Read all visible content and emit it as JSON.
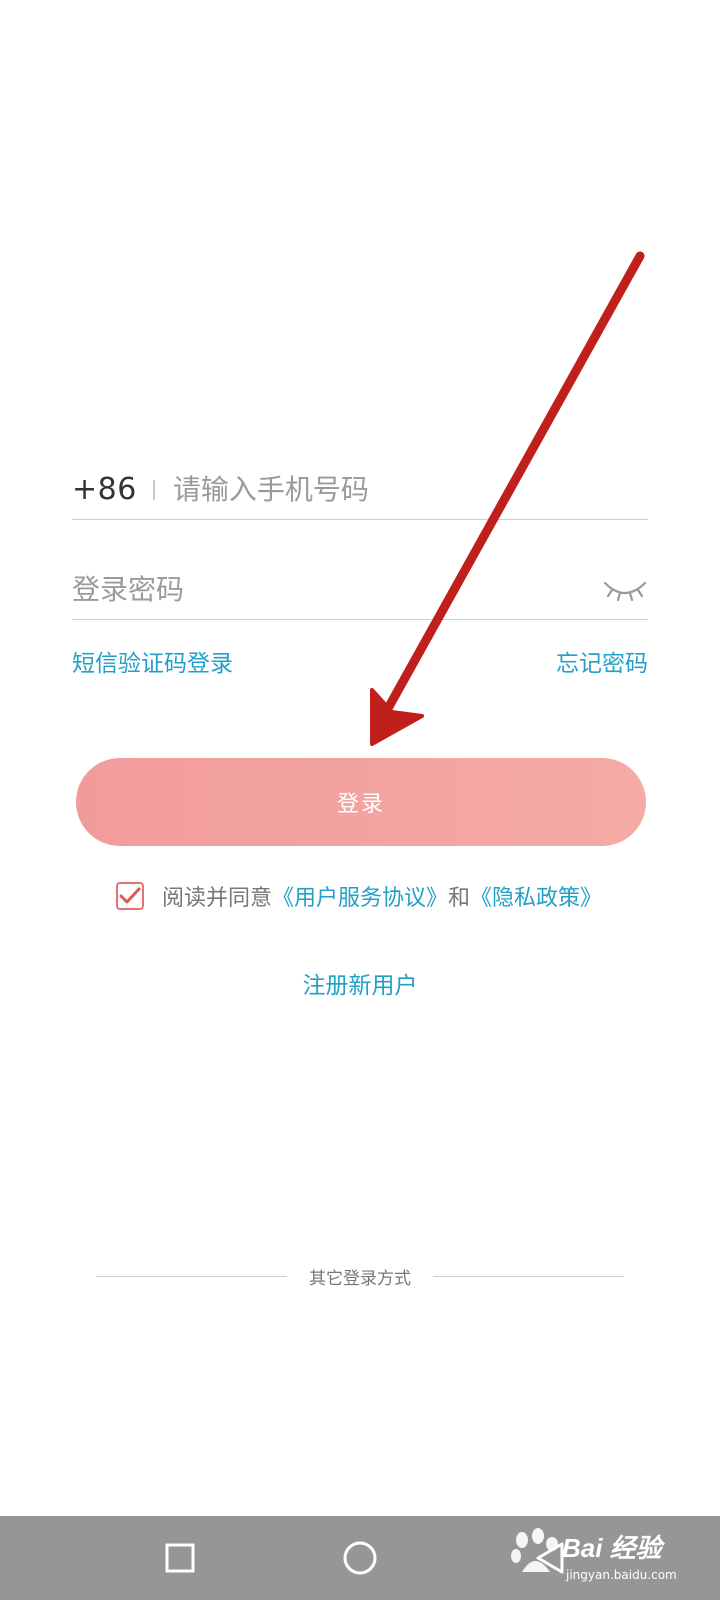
{
  "login": {
    "country_code": "+86",
    "phone_placeholder": "请输入手机号码",
    "password_placeholder": "登录密码",
    "sms_login_label": "短信验证码登录",
    "forgot_password_label": "忘记密码",
    "login_button_label": "登录",
    "agreement": {
      "checked": true,
      "prefix": "阅读并同意",
      "terms_link": "《用户服务协议》",
      "conjunction": "和",
      "privacy_link": "《隐私政策》"
    },
    "register_label": "注册新用户",
    "other_login_label": "其它登录方式"
  },
  "icons": {
    "password_toggle": "eye-closed-icon",
    "checkbox": "checkmark-icon",
    "nav_recent": "square-icon",
    "nav_home": "circle-icon",
    "nav_back": "triangle-back-icon"
  },
  "colors": {
    "accent_link": "#21a0c8",
    "login_button": "#f19c9c",
    "checkbox_border": "#e57373",
    "annotation_arrow": "#c0201b",
    "nav_bar": "#969696"
  },
  "watermark": {
    "main": "Bai 经验",
    "sub": "jingyan.baidu.com"
  }
}
